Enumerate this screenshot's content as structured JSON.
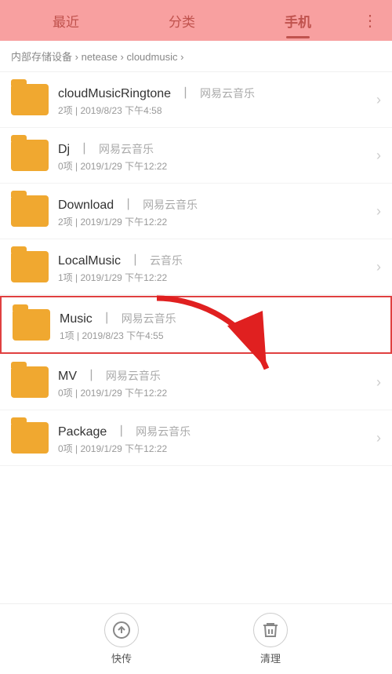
{
  "tabs": [
    {
      "id": "recent",
      "label": "最近",
      "active": false
    },
    {
      "id": "category",
      "label": "分类",
      "active": false
    },
    {
      "id": "phone",
      "label": "手机",
      "active": true
    }
  ],
  "more_icon": "⋮",
  "breadcrumb": {
    "parts": [
      "内部存储设备",
      "netease",
      "cloudmusic"
    ]
  },
  "folders": [
    {
      "name": "cloudMusicRingtone",
      "source": "网易云音乐",
      "count": "2项",
      "date": "2019/8/23 下午4:58",
      "highlighted": false
    },
    {
      "name": "Dj",
      "source": "网易云音乐",
      "count": "0项",
      "date": "2019/1/29 下午12:22",
      "highlighted": false
    },
    {
      "name": "Download",
      "source": "网易云音乐",
      "count": "2项",
      "date": "2019/1/29 下午12:22",
      "highlighted": false
    },
    {
      "name": "LocalMusic",
      "source": "云音乐",
      "count": "1项",
      "date": "2019/1/29 下午12:22",
      "highlighted": false
    },
    {
      "name": "Music",
      "source": "网易云音乐",
      "count": "1项",
      "date": "2019/8/23 下午4:55",
      "highlighted": true
    },
    {
      "name": "MV",
      "source": "网易云音乐",
      "count": "0项",
      "date": "2019/1/29 下午12:22",
      "highlighted": false
    },
    {
      "name": "Package",
      "source": "网易云音乐",
      "count": "0项",
      "date": "2019/1/29 下午12:22",
      "highlighted": false
    }
  ],
  "bottom_buttons": [
    {
      "id": "quick-transfer",
      "label": "快传",
      "icon": "↑"
    },
    {
      "id": "clean",
      "label": "清理",
      "icon": "✂"
    }
  ],
  "separator": "丨"
}
